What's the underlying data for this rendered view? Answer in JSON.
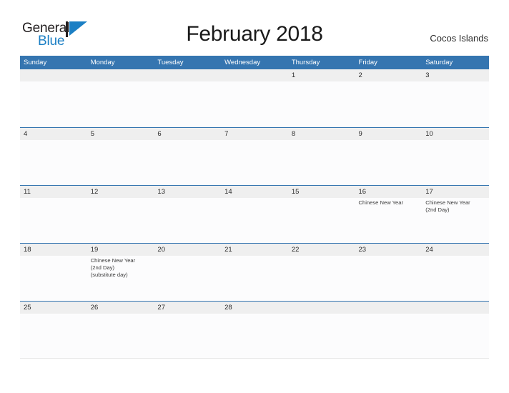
{
  "brand": {
    "name_part1": "General",
    "name_part2": "Blue",
    "logo_icon": "sail-triangle-icon",
    "color_dark": "#231f20",
    "color_blue": "#1b7fc4"
  },
  "header": {
    "title": "February 2018",
    "location": "Cocos Islands"
  },
  "theme": {
    "header_bar": "#3575b0",
    "day_band": "#efefef",
    "row_divider": "#3575b0",
    "text": "#333333"
  },
  "calendar": {
    "month": "February",
    "year": "2018",
    "weekdays": [
      "Sunday",
      "Monday",
      "Tuesday",
      "Wednesday",
      "Thursday",
      "Friday",
      "Saturday"
    ],
    "weeks": [
      [
        {
          "date": "",
          "events": []
        },
        {
          "date": "",
          "events": []
        },
        {
          "date": "",
          "events": []
        },
        {
          "date": "",
          "events": []
        },
        {
          "date": "1",
          "events": []
        },
        {
          "date": "2",
          "events": []
        },
        {
          "date": "3",
          "events": []
        }
      ],
      [
        {
          "date": "4",
          "events": []
        },
        {
          "date": "5",
          "events": []
        },
        {
          "date": "6",
          "events": []
        },
        {
          "date": "7",
          "events": []
        },
        {
          "date": "8",
          "events": []
        },
        {
          "date": "9",
          "events": []
        },
        {
          "date": "10",
          "events": []
        }
      ],
      [
        {
          "date": "11",
          "events": []
        },
        {
          "date": "12",
          "events": []
        },
        {
          "date": "13",
          "events": []
        },
        {
          "date": "14",
          "events": []
        },
        {
          "date": "15",
          "events": []
        },
        {
          "date": "16",
          "events": [
            "Chinese New Year"
          ]
        },
        {
          "date": "17",
          "events": [
            "Chinese New Year",
            "(2nd Day)"
          ]
        }
      ],
      [
        {
          "date": "18",
          "events": []
        },
        {
          "date": "19",
          "events": [
            "Chinese New Year",
            "(2nd Day)",
            "(substitute day)"
          ]
        },
        {
          "date": "20",
          "events": []
        },
        {
          "date": "21",
          "events": []
        },
        {
          "date": "22",
          "events": []
        },
        {
          "date": "23",
          "events": []
        },
        {
          "date": "24",
          "events": []
        }
      ],
      [
        {
          "date": "25",
          "events": []
        },
        {
          "date": "26",
          "events": []
        },
        {
          "date": "27",
          "events": []
        },
        {
          "date": "28",
          "events": []
        },
        {
          "date": "",
          "events": []
        },
        {
          "date": "",
          "events": []
        },
        {
          "date": "",
          "events": []
        }
      ]
    ]
  }
}
